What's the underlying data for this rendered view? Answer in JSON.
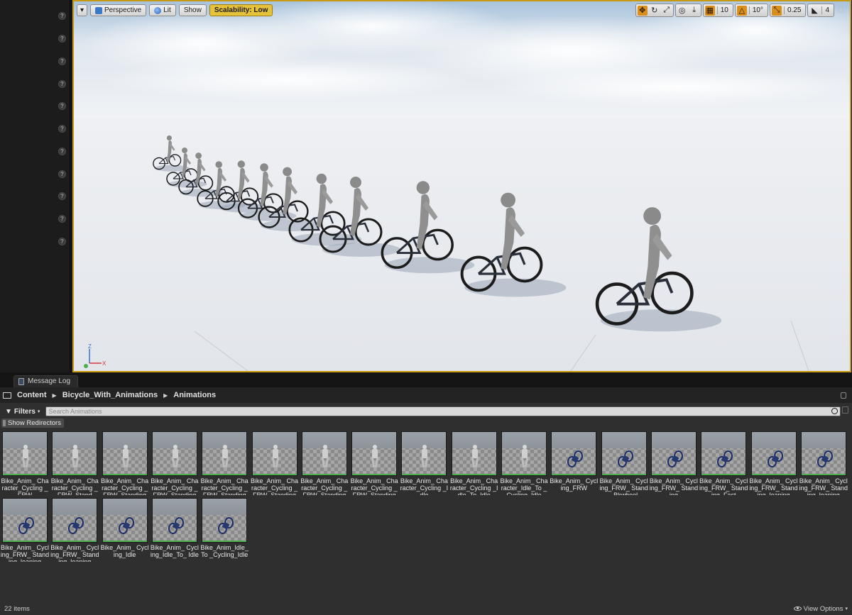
{
  "viewport": {
    "view_mode": "Perspective",
    "lighting": "Lit",
    "show": "Show",
    "scalability": "Scalability: Low",
    "grid_snap": "10",
    "rotation_snap": "10°",
    "scale_snap": "0.25",
    "camera_speed": "4",
    "axis": {
      "x": "X",
      "z": "Z"
    }
  },
  "tabs": [
    {
      "label": "Message Log"
    }
  ],
  "breadcrumb": [
    "Content",
    "Bicycle_With_Animations",
    "Animations"
  ],
  "filters_label": "Filters",
  "search_placeholder": "Search Animations",
  "redirectors_label": "Show Redirectors",
  "assets": [
    {
      "label": "Bike_Anim_ Character_Cycling _FRW",
      "kind": "character"
    },
    {
      "label": "Bike_Anim_ Character_Cycling _FRW_Stand",
      "kind": "character"
    },
    {
      "label": "Bike_Anim_ Character_Cycling _FRW_Standing",
      "kind": "character"
    },
    {
      "label": "Bike_Anim_ Character_Cycling _FRW_Standing",
      "kind": "character"
    },
    {
      "label": "Bike_Anim_ Character_Cycling _FRW_Standing",
      "kind": "character"
    },
    {
      "label": "Bike_Anim_ Character_Cycling _FRW_Standing",
      "kind": "character"
    },
    {
      "label": "Bike_Anim_ Character_Cycling _FRW_Standing",
      "kind": "character"
    },
    {
      "label": "Bike_Anim_ Character_Cycling _FRW_Standing",
      "kind": "character"
    },
    {
      "label": "Bike_Anim_ Character_Cycling _Idle",
      "kind": "character"
    },
    {
      "label": "Bike_Anim_ Character_Cycling _Idle_To_Idle",
      "kind": "character"
    },
    {
      "label": "Bike_Anim_ Character_Idle_To _Cycling_Idle",
      "kind": "character"
    },
    {
      "label": "Bike_Anim_ Cycling_FRW",
      "kind": "bike"
    },
    {
      "label": "Bike_Anim_ Cycling_FRW_ Stand_Bkwheel",
      "kind": "bike"
    },
    {
      "label": "Bike_Anim_ Cycling_FRW_ Standing",
      "kind": "bike"
    },
    {
      "label": "Bike_Anim_ Cycling_FRW_ Standing_Fast",
      "kind": "bike"
    },
    {
      "label": "Bike_Anim_ Cycling_FRW_ Standing_leaning",
      "kind": "bike"
    },
    {
      "label": "Bike_Anim_ Cycling_FRW_ Standing_leaning",
      "kind": "bike"
    },
    {
      "label": "Bike_Anim_ Cycling_FRW_ Standing_leaning",
      "kind": "bike"
    },
    {
      "label": "Bike_Anim_ Cycling_FRW_ Standing_leaning",
      "kind": "bike"
    },
    {
      "label": "Bike_Anim_ Cycling_Idle",
      "kind": "bike"
    },
    {
      "label": "Bike_Anim_ Cycling_Idle_To_ Idle",
      "kind": "bike"
    },
    {
      "label": "Bike_Anim_Idle_To _Cycling_Idle",
      "kind": "bike"
    }
  ],
  "status": {
    "item_count": "22 items",
    "view_options": "View Options"
  }
}
